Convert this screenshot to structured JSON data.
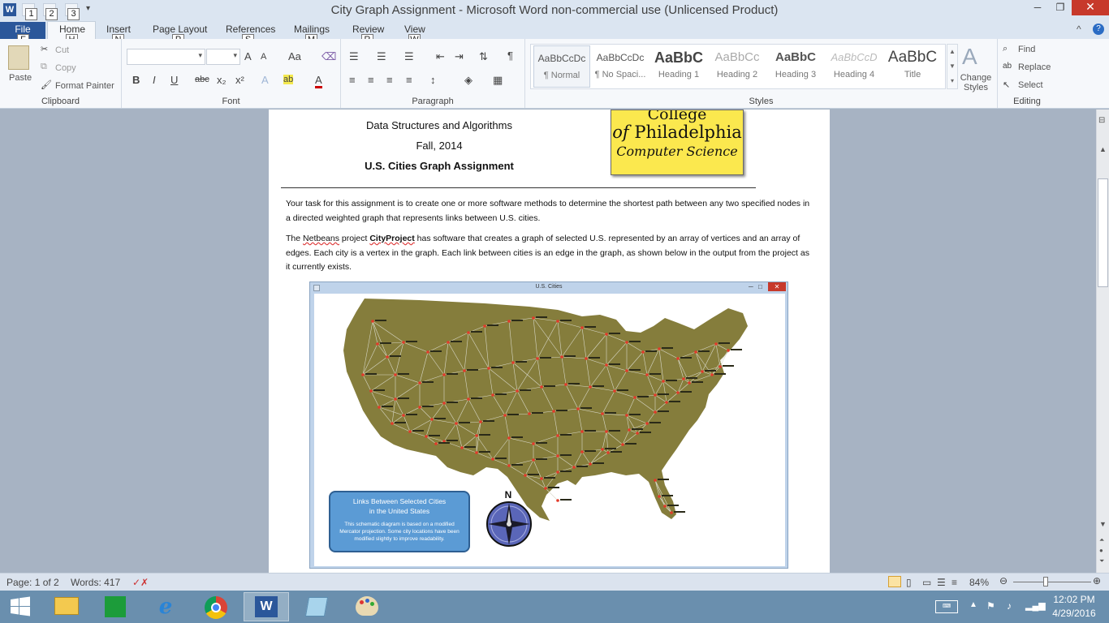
{
  "window": {
    "title": "City Graph Assignment  -  Microsoft Word non-commercial use (Unlicensed Product)"
  },
  "qat": {
    "keytips": [
      "1",
      "2",
      "3"
    ],
    "app_icon": "W"
  },
  "ribbon_tabs": {
    "file": "File",
    "items": [
      "Home",
      "Insert",
      "Page Layout",
      "References",
      "Mailings",
      "Review",
      "View"
    ],
    "keytips": [
      "F",
      "H",
      "N",
      "P",
      "S",
      "M",
      "R",
      "W"
    ]
  },
  "clipboard": {
    "paste": "Paste",
    "cut": "Cut",
    "copy": "Copy",
    "format_painter": "Format Painter",
    "label": "Clipboard"
  },
  "font": {
    "label": "Font",
    "grow": "A",
    "shrink": "A",
    "change_case": "Aa",
    "bold": "B",
    "italic": "I",
    "underline": "U",
    "strike": "abc",
    "sub": "x₂",
    "sup": "x²",
    "text_effects": "A",
    "highlight": "ab",
    "font_color": "A"
  },
  "paragraph": {
    "label": "Paragraph",
    "pilcrow": "¶"
  },
  "styles": {
    "label": "Styles",
    "items": [
      {
        "preview": "AaBbCcDc",
        "name": "¶ Normal"
      },
      {
        "preview": "AaBbCcDc",
        "name": "¶ No Spaci..."
      },
      {
        "preview": "AaBbC",
        "name": "Heading 1"
      },
      {
        "preview": "AaBbCc",
        "name": "Heading 2"
      },
      {
        "preview": "AaBbC",
        "name": "Heading 3"
      },
      {
        "preview": "AaBbCcD",
        "name": "Heading 4"
      },
      {
        "preview": "AaBbC",
        "name": "Title"
      }
    ],
    "change_styles": "Change Styles"
  },
  "editing": {
    "label": "Editing",
    "find": "Find",
    "replace": "Replace",
    "select": "Select"
  },
  "document": {
    "header_line1": "Data Structures and Algorithms",
    "header_line2": "Fall, 2014",
    "header_line3": "U.S. Cities Graph Assignment",
    "logo_line1": "College",
    "logo_line2a": "of",
    "logo_line2b": "Philadelphia",
    "logo_line3": "Computer Science",
    "para1": "Your task for this assignment is to create one or more software methods to determine the shortest path between any two specified nodes in a directed weighted graph that represents links between U.S. cities.",
    "para2_a": "The ",
    "para2_netbeans": "Netbeans",
    "para2_b": " project ",
    "para2_project": "CityProject",
    "para2_c": " has software that creates a graph of selected U.S. represented by an array of vertices and an array of edges.  Each city is a vertex in the graph.  Each link between cities is an edge in the graph, as shown below in the output from the project as it currently exists."
  },
  "figure": {
    "window_title": "U.S. Cities",
    "legend_title1": "Links Between Selected Cities",
    "legend_title2": "in the United States",
    "legend_body": "This schematic diagram is based on a modified Mercator projection.  Some city locations have been modified slightly to improve readability.",
    "compass_label": "N",
    "colors": {
      "land": "#857d3c",
      "edge": "#d8d8c8",
      "node": "#e23a2a",
      "legend_bg": "#5b9bd5"
    }
  },
  "statusbar": {
    "page": "Page: 1 of 2",
    "words": "Words: 417",
    "zoom": "84%"
  },
  "taskbar": {
    "time": "12:02 PM",
    "date": "4/29/2016"
  }
}
